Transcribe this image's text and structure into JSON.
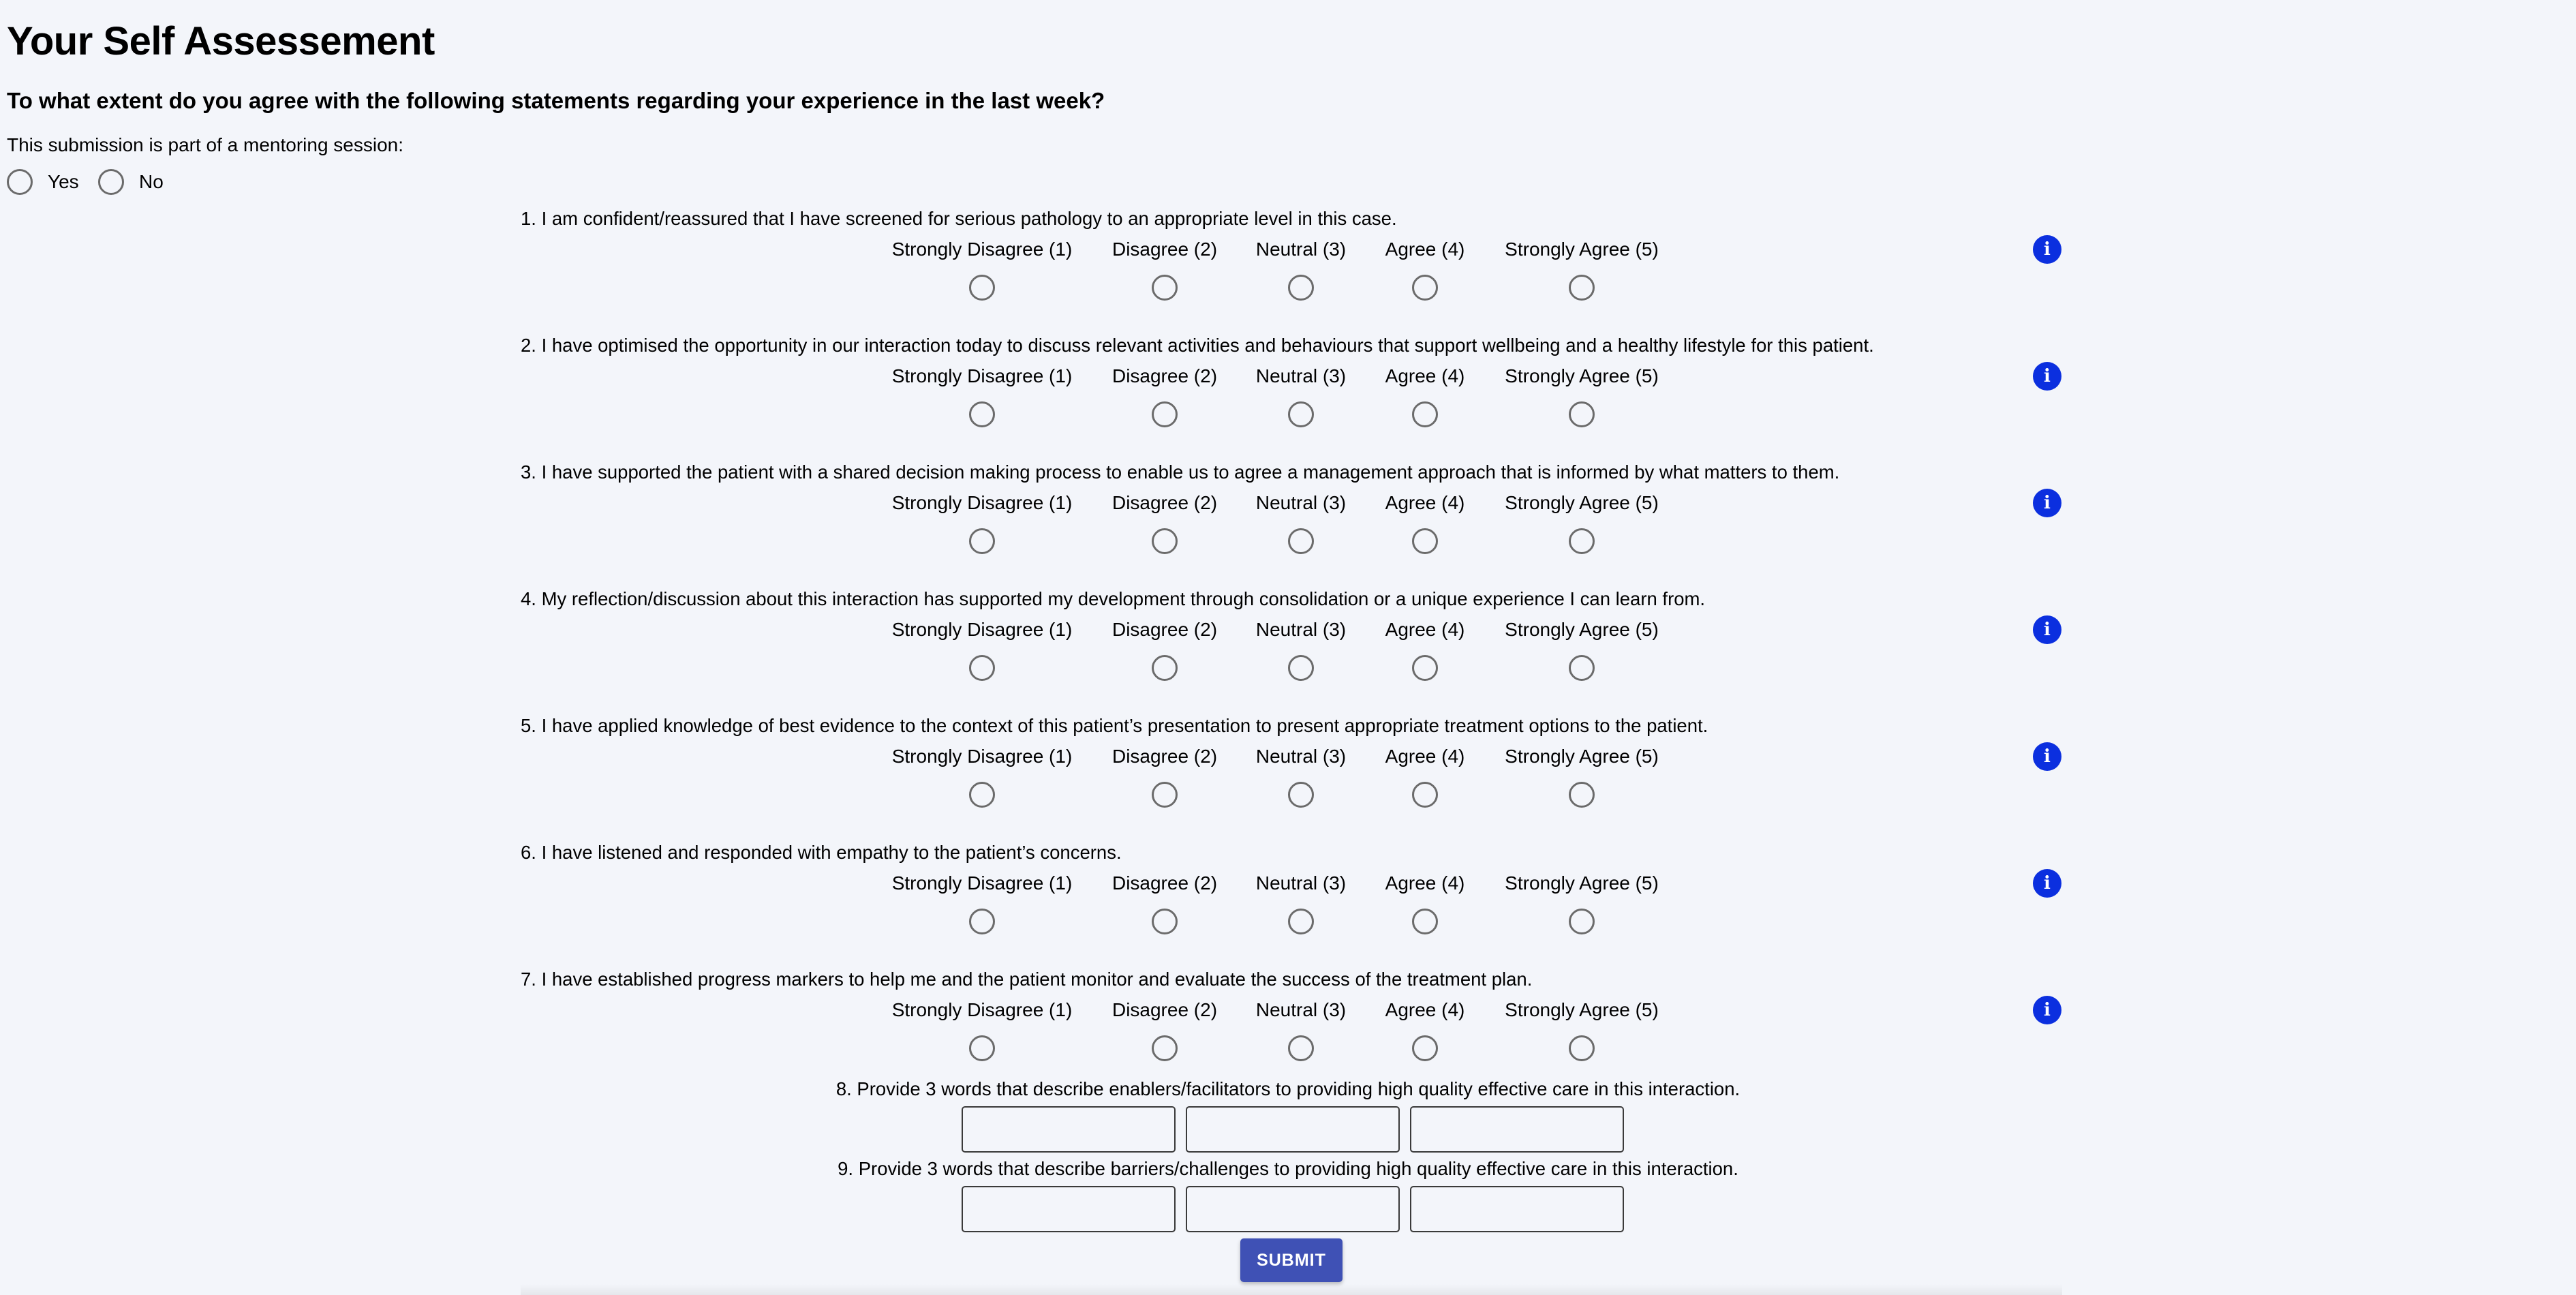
{
  "page": {
    "title": "Your Self Assessement",
    "subtitle": "To what extent do you agree with the following statements regarding your experience in the last week?"
  },
  "mentoring": {
    "label": "This submission is part of a mentoring session:",
    "yes_label": "Yes",
    "no_label": "No"
  },
  "scale_labels": [
    "Strongly Disagree (1)",
    "Disagree (2)",
    "Neutral (3)",
    "Agree (4)",
    "Strongly Agree (5)"
  ],
  "questions": [
    {
      "text": "1. I am confident/reassured that I have screened for serious pathology to an appropriate level in this case."
    },
    {
      "text": "2. I have optimised the opportunity in our interaction today to discuss relevant activities and behaviours that support wellbeing and a healthy lifestyle for this patient."
    },
    {
      "text": "3. I have supported the patient with a shared decision making process to enable us to agree a management approach that is informed by what matters to them."
    },
    {
      "text": "4. My reflection/discussion about this interaction has supported my development through consolidation or a unique experience I can learn from."
    },
    {
      "text": "5. I have applied knowledge of best evidence to the context of this patient’s presentation to present appropriate treatment options to the patient."
    },
    {
      "text": "6. I have listened and responded with empathy to the patient’s concerns."
    },
    {
      "text": "7. I have established progress markers to help me and the patient monitor and evaluate the success of the treatment plan."
    }
  ],
  "word_questions": [
    {
      "text": "8. Provide 3 words that describe enablers/facilitators to providing high quality effective care in this interaction.",
      "values": [
        "",
        "",
        ""
      ]
    },
    {
      "text": "9. Provide 3 words that describe barriers/challenges to providing high quality effective care in this interaction.",
      "values": [
        "",
        "",
        ""
      ]
    }
  ],
  "submit_label": "SUBMIT",
  "icons": {
    "info": "info-icon",
    "info_glyph": "i"
  },
  "colors": {
    "background": "#f3f5fa",
    "info_icon": "#0b2fdf",
    "submit_button": "#3f51b5",
    "radio_border": "#6b6b6b"
  }
}
